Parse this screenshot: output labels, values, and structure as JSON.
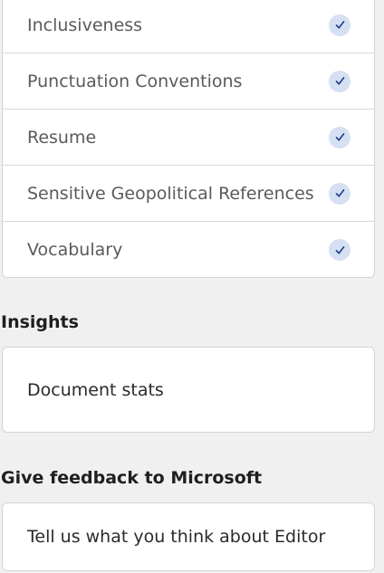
{
  "checks": {
    "items": [
      {
        "label": "Inclusiveness",
        "icon": "checkmark-icon",
        "checked": true
      },
      {
        "label": "Punctuation Conventions",
        "icon": "checkmark-icon",
        "checked": true
      },
      {
        "label": "Resume",
        "icon": "checkmark-icon",
        "checked": true
      },
      {
        "label": "Sensitive Geopolitical References",
        "icon": "checkmark-icon",
        "checked": true
      },
      {
        "label": "Vocabulary",
        "icon": "checkmark-icon",
        "checked": true
      }
    ]
  },
  "insights": {
    "heading": "Insights",
    "document_stats_label": "Document stats"
  },
  "feedback": {
    "heading": "Give feedback to Microsoft",
    "link_label": "Tell us what you think about Editor"
  },
  "colors": {
    "background": "#f0f0f0",
    "card": "#ffffff",
    "check_circle": "#d5e0f3",
    "check_mark": "#1f3f8f"
  }
}
